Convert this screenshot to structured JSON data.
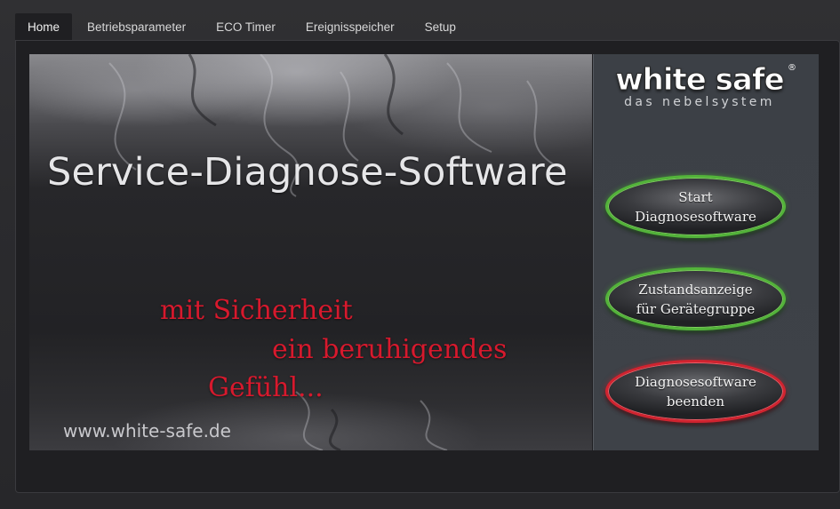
{
  "tabs": [
    {
      "label": "Home",
      "active": true
    },
    {
      "label": "Betriebsparameter",
      "active": false
    },
    {
      "label": "ECO Timer",
      "active": false
    },
    {
      "label": "Ereignisspeicher",
      "active": false
    },
    {
      "label": "Setup",
      "active": false
    }
  ],
  "banner": {
    "title": "Service-Diagnose-Software",
    "tagline": [
      "mit Sicherheit",
      "ein beruhigendes",
      "Gefühl..."
    ],
    "url": "www.white-safe.de",
    "tagline_color": "#d7192d"
  },
  "logo": {
    "brand": "white safe",
    "registered": "®",
    "subtitle": "das nebelsystem"
  },
  "buttons": {
    "start": {
      "line1": "Start",
      "line2": "Diagnosesoftware",
      "ring_color": "#53b43a"
    },
    "status": {
      "line1": "Zustandsanzeige",
      "line2": "für Gerätegruppe",
      "ring_color": "#53b43a"
    },
    "quit": {
      "line1": "Diagnosesoftware",
      "line2": "beenden",
      "ring_color": "#d1232f"
    }
  }
}
